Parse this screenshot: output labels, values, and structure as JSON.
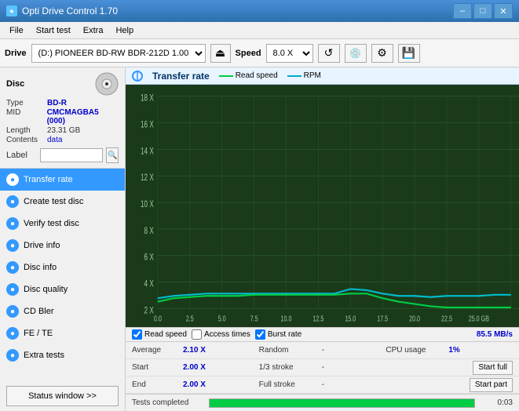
{
  "titleBar": {
    "title": "Opti Drive Control 1.70",
    "minBtn": "–",
    "maxBtn": "□",
    "closeBtn": "✕"
  },
  "menuBar": {
    "items": [
      "File",
      "Start test",
      "Extra",
      "Help"
    ]
  },
  "toolbar": {
    "driveLabel": "Drive",
    "driveValue": "(D:) PIONEER BD-RW  BDR-212D 1.00",
    "speedLabel": "Speed",
    "speedValue": "8.0 X"
  },
  "disc": {
    "typeLabel": "Type",
    "typeValue": "BD-R",
    "midLabel": "MID",
    "midValue": "CMCMAGBA5 (000)",
    "lengthLabel": "Length",
    "lengthValue": "23.31 GB",
    "contentsLabel": "Contents",
    "contentsValue": "data",
    "labelLabel": "Label",
    "labelValue": ""
  },
  "nav": {
    "items": [
      {
        "id": "transfer-rate",
        "label": "Transfer rate",
        "active": true
      },
      {
        "id": "create-test-disc",
        "label": "Create test disc",
        "active": false
      },
      {
        "id": "verify-test-disc",
        "label": "Verify test disc",
        "active": false
      },
      {
        "id": "drive-info",
        "label": "Drive info",
        "active": false
      },
      {
        "id": "disc-info",
        "label": "Disc info",
        "active": false
      },
      {
        "id": "disc-quality",
        "label": "Disc quality",
        "active": false
      },
      {
        "id": "cd-bler",
        "label": "CD Bler",
        "active": false
      },
      {
        "id": "fe-te",
        "label": "FE / TE",
        "active": false
      },
      {
        "id": "extra-tests",
        "label": "Extra tests",
        "active": false
      }
    ],
    "statusBtn": "Status window >>"
  },
  "chart": {
    "title": "Transfer rate",
    "legend": [
      {
        "label": "Read speed",
        "color": "#00cc44"
      },
      {
        "label": "RPM",
        "color": "#00aacc"
      }
    ],
    "yAxis": [
      "18 X",
      "16 X",
      "14 X",
      "12 X",
      "10 X",
      "8 X",
      "6 X",
      "4 X",
      "2 X"
    ],
    "xAxis": [
      "0.0",
      "2.5",
      "5.0",
      "7.5",
      "10.0",
      "12.5",
      "15.0",
      "17.5",
      "20.0",
      "22.5",
      "25.0 GB"
    ]
  },
  "statsBar": {
    "readSpeedChecked": true,
    "readSpeedLabel": "Read speed",
    "accessTimesChecked": false,
    "accessTimesLabel": "Access times",
    "burstRateChecked": true,
    "burstRateLabel": "Burst rate",
    "burstRateValue": "85.5 MB/s"
  },
  "statsRows": [
    {
      "col1Label": "Average",
      "col1Value": "2.10 X",
      "col2Label": "Random",
      "col2Value": "-",
      "col3Label": "CPU usage",
      "col3Value": "1%",
      "btn": null
    },
    {
      "col1Label": "Start",
      "col1Value": "2.00 X",
      "col2Label": "1/3 stroke",
      "col2Value": "-",
      "col3Label": "",
      "col3Value": "",
      "btn": "Start full"
    },
    {
      "col1Label": "End",
      "col1Value": "2.00 X",
      "col2Label": "Full stroke",
      "col2Value": "-",
      "col3Label": "",
      "col3Value": "",
      "btn": "Start part"
    }
  ],
  "progress": {
    "label": "Tests completed",
    "percent": 100,
    "time": "0:03"
  }
}
